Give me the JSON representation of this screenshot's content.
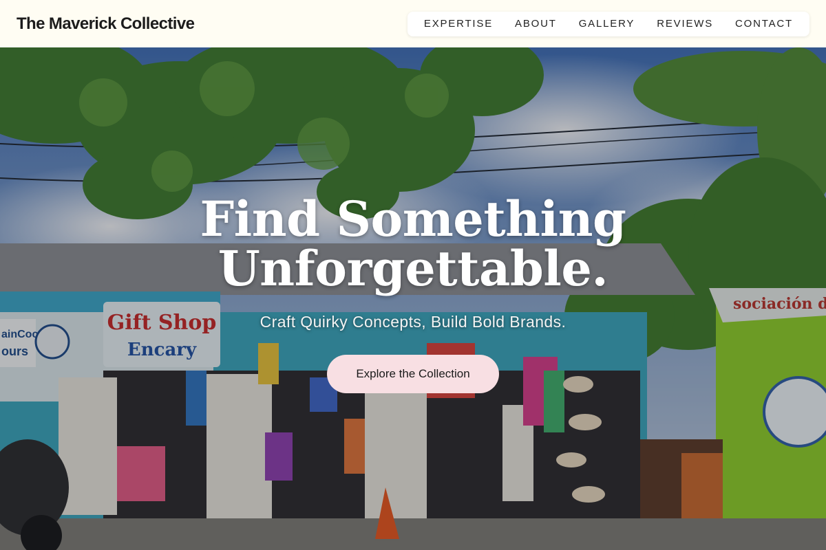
{
  "header": {
    "brand": "The Maverick Collective",
    "nav": [
      {
        "label": "EXPERTISE"
      },
      {
        "label": "ABOUT"
      },
      {
        "label": "GALLERY"
      },
      {
        "label": "REVIEWS"
      },
      {
        "label": "CONTACT"
      }
    ]
  },
  "hero": {
    "title_line1": "Find Something",
    "title_line2": "Unforgettable.",
    "subtitle": "Craft Quirky Concepts, Build Bold Brands.",
    "cta": "Explore the Collection",
    "sign_gift": "Gift Shop",
    "sign_encary": "Encary",
    "sign_tours_1": "ainCoco",
    "sign_tours_2": "ours",
    "sign_asociacion": "sociación de tr"
  },
  "colors": {
    "header_bg": "#fffdf3",
    "cta_bg": "#f8dfe3",
    "shop_teal": "#3aa6bd",
    "kiosk_green": "#8ecf2a"
  }
}
